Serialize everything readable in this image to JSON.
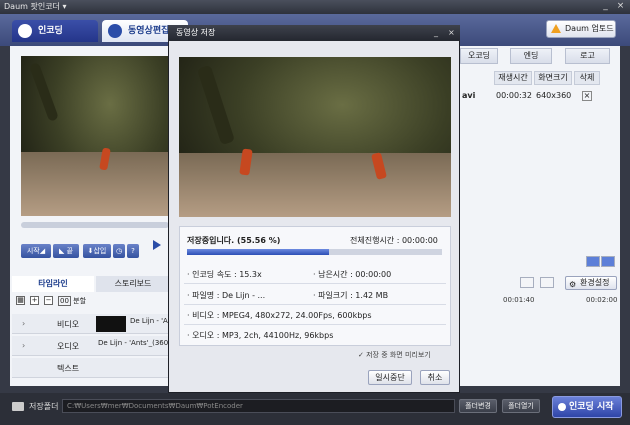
{
  "app": {
    "title": "Daum 팟인코더 ▾"
  },
  "window_buttons": {
    "minimize": "_",
    "close": "×"
  },
  "top_tabs": {
    "encoding": "인코딩",
    "video_edit": "동영상편집"
  },
  "upgrade": {
    "label": "Daum 업토드"
  },
  "left": {
    "controls": {
      "start": "시작◢",
      "end": "◣ 끝",
      "insert": "⬇삽입",
      "clock": "◷",
      "help": "?"
    },
    "timeline_tabs": {
      "timeline": "타임라인",
      "storyboard": "스토리보드"
    },
    "split_label": "분할",
    "rows": [
      {
        "expand": "›",
        "label": "비디오",
        "clip": "De Lijn - 'A"
      },
      {
        "expand": "›",
        "label": "오디오",
        "clip": "De Lijn - 'Ants'_(360p"
      },
      {
        "expand": "",
        "label": "텍스트",
        "clip": ""
      }
    ]
  },
  "right": {
    "tabs": [
      "오코딩",
      "엔딩",
      "로고"
    ],
    "columns": [
      "재생시간",
      "화면크기",
      "삭제"
    ],
    "file_row": {
      "name_tail": "avi",
      "duration": "00:00:32",
      "size": "640x360",
      "delete": "×"
    },
    "env_settings": "환경설정",
    "ruler": [
      "00:01:40",
      "00:02:00"
    ]
  },
  "bottom": {
    "folder_label": "저장폴더",
    "folder_path": "C:₩Users₩mer₩Documents₩Daum₩PotEncoder",
    "change_folder": "폴더변경",
    "open_folder": "폴더열기",
    "start_encoding": "인코딩 시작"
  },
  "dialog": {
    "title": "동영상 저장",
    "status": "저장중입니다. (55.56 %)",
    "total_time": "전체진행시간 : 00:00:00",
    "progress": 0.5556,
    "encoding_speed": "· 인코딩 속도 : 15.3x",
    "remaining_time": "· 남은시간 : 00:00:00",
    "file_name": "· 파일명 : De Lijn - ...",
    "file_size": "· 파일크기 : 1.42 MB",
    "video_info": "· 비디오 : MPEG4, 480x272, 24.00Fps, 600kbps",
    "audio_info": "· 오디오 : MP3, 2ch, 44100Hz, 96kbps",
    "preview_check": "✓ 저장 중 화면 미리보기",
    "pause_button": "일시중단",
    "cancel_button": "취소"
  }
}
